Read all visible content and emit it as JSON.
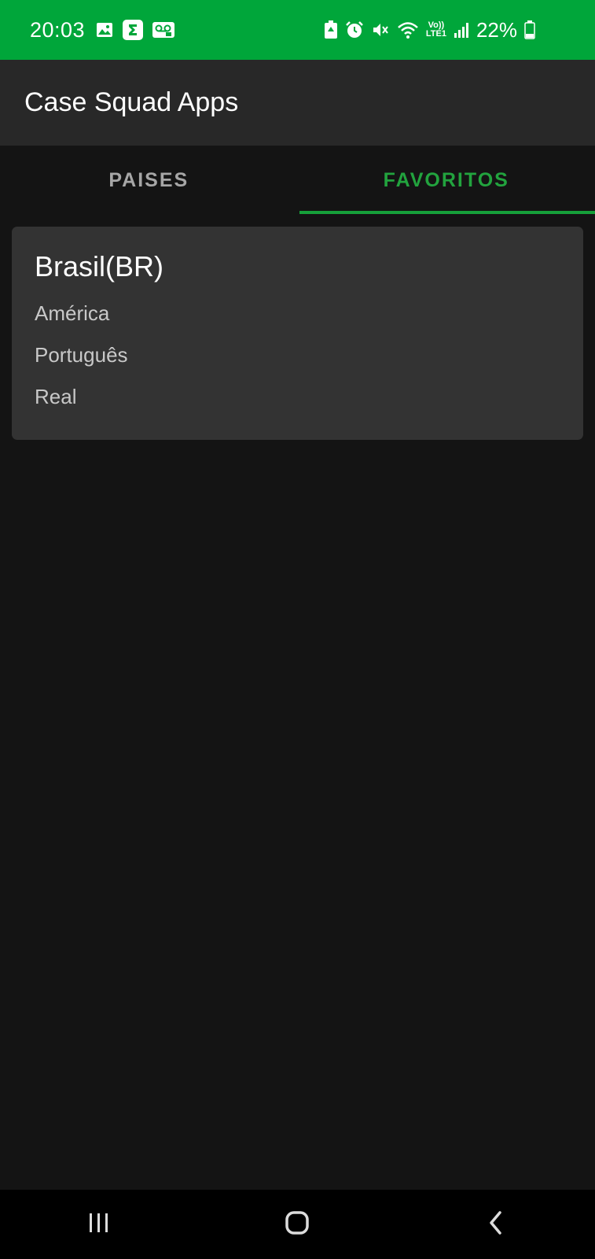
{
  "status_bar": {
    "time": "20:03",
    "battery": "22%",
    "background_color": "#00a63a",
    "left_icons": [
      "gallery-icon",
      "sigma-app-icon",
      "voicemail-icon"
    ],
    "right_icons": [
      "battery-saver-icon",
      "alarm-icon",
      "mute-icon",
      "wifi-icon",
      "volte-icon",
      "signal-icon",
      "battery-icon"
    ],
    "volte_label": "Vo))",
    "lte_label": "LTE1"
  },
  "app_bar": {
    "title": "Case Squad Apps",
    "background_color": "#282828"
  },
  "tabs": [
    {
      "label": "PAISES",
      "active": false
    },
    {
      "label": "FAVORITOS",
      "active": true
    }
  ],
  "accent_color": "#16a03a",
  "favorites": [
    {
      "name": "Brasil(BR)",
      "region": "América",
      "language": "Português",
      "currency": "Real"
    }
  ],
  "nav_bar": {
    "buttons": [
      "recent-apps-icon",
      "home-icon",
      "back-icon"
    ]
  }
}
